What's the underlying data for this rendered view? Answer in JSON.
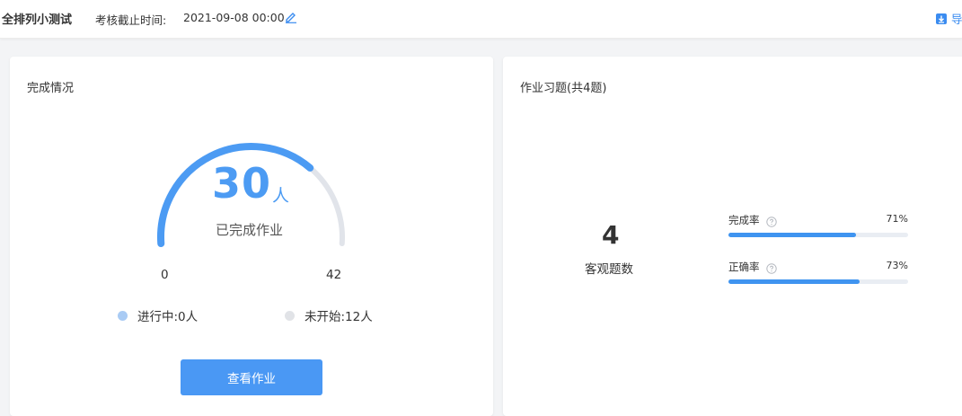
{
  "header": {
    "exam_title": "全排列小测试",
    "deadline_label": "考核截止时间:",
    "deadline_value": "2021-09-08 00:00",
    "export_label": "导"
  },
  "completion_card": {
    "title": "完成情况",
    "completed_count": "30",
    "unit": "人",
    "caption": "已完成作业",
    "gauge_min": "0",
    "gauge_max": "42",
    "completed_fraction": 0.714,
    "legend": {
      "in_progress": "进行中:0人",
      "not_started": "未开始:12人"
    },
    "view_button": "查看作业",
    "colors": {
      "progress": "#4c9bf3",
      "track": "#e1e4ea",
      "in_progress_dot": "#a9cbf4",
      "not_started_dot": "#e1e3e7"
    }
  },
  "exercise_card": {
    "title": "作业习题(共4题)",
    "question_count": "4",
    "question_count_label": "客观题数",
    "stats": {
      "completion_label": "完成率",
      "completion_value": "71%",
      "completion_fraction": 0.71,
      "accuracy_label": "正确率",
      "accuracy_value": "73%",
      "accuracy_fraction": 0.73
    }
  },
  "icons": {
    "edit": "edit-icon",
    "export": "download-icon",
    "help": "help-circle-icon"
  }
}
